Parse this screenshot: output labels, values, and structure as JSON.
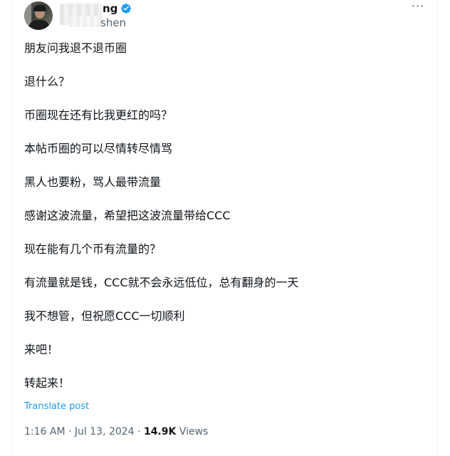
{
  "tweet": {
    "author": {
      "name_visible": "ng",
      "handle_visible": "shen",
      "verified": true
    },
    "lines": [
      "朋友问我退不退币圈",
      "退什么？",
      "币圈现在还有比我更红的吗？",
      "本帖币圈的可以尽情转尽情骂",
      "黑人也要粉，骂人最带流量",
      "感谢这波流量，希望把这波流量带给CCC",
      "现在能有几个币有流量的？",
      "有流量就是钱，CCC就不会永远低位，总有翻身的一天",
      "我不想管，但祝愿CCC一切顺利",
      "来吧！",
      "转起来！"
    ],
    "translate_label": "Translate post",
    "time": "1:16 AM",
    "separator": "·",
    "date": "Jul 13, 2024",
    "views_count": "14.9K",
    "views_label": "Views"
  },
  "colors": {
    "text": "#0f1419",
    "secondary": "#536471",
    "link": "#1d9bf0",
    "verified": "#1d9bf0"
  },
  "icons": {
    "more": "more-dots-icon",
    "verified": "verified-badge-icon"
  }
}
